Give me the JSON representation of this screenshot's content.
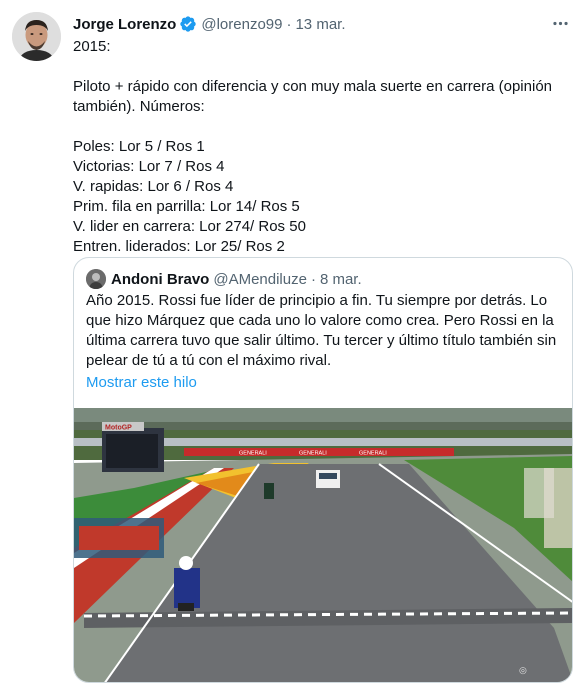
{
  "tweet": {
    "author_name": "Jorge Lorenzo",
    "verified_icon": "verified-badge-icon",
    "handle": "@lorenzo99",
    "separator": "·",
    "date": "13 mar.",
    "more_icon": "more-horizontal-icon",
    "lines": [
      "2015:",
      "Piloto + rápido con diferencia y con muy mala suerte en carrera (opinión también). Números:",
      "Poles: Lor 5 / Ros 1",
      "Victorias: Lor 7 / Ros 4",
      "V. rapidas: Lor 6 / Ros 4",
      "Prim. fila en parrilla: Lor 14/ Ros 5",
      "V. lider en carrera: Lor 274/ Ros 50",
      "Entren. liderados: Lor 25/ Ros 2"
    ]
  },
  "quote": {
    "author_name": "Andoni Bravo",
    "handle": "@AMendiluze",
    "separator": "·",
    "date": "8 mar.",
    "text": "Año 2015. Rossi fue líder de principio a fin. Tu siempre por detrás. Lo que hizo Márquez que cada uno lo valore como crea. Pero Rossi en la última carrera tuvo que salir último. Tu tercer y último título también sin pelear de tú a tú con el máximo rival.",
    "show_thread": "Mostrar este hilo",
    "media": {
      "motogp_board": "MotoGP",
      "banner": "GENERALI"
    }
  },
  "colors": {
    "text": "#0f1419",
    "secondary": "#536471",
    "link": "#1d9bf0",
    "border": "#cfd9de"
  }
}
